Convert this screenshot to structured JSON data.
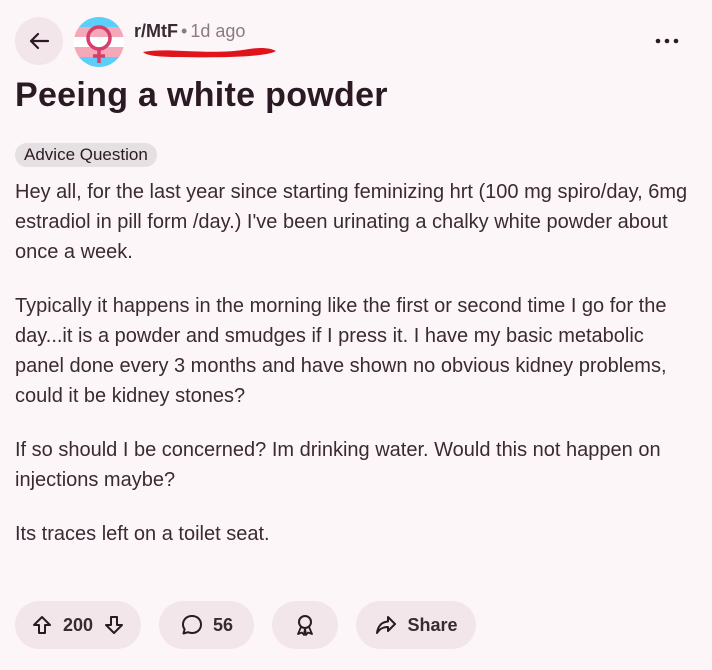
{
  "header": {
    "subreddit": "r/MtF",
    "separator": "•",
    "age": "1d ago"
  },
  "post": {
    "title": "Peeing a white powder",
    "flair": "Advice Question",
    "paragraphs": [
      "Hey all, for the last year since starting feminizing hrt (100 mg spiro/day, 6mg estradiol in pill form /day.) I've been urinating a chalky white powder about once a week.",
      "Typically it happens in the morning like the first or second time I go for the day...it is a powder and smudges if I press it. I have my basic metabolic panel done every 3 months and have shown no obvious kidney problems, could it be kidney stones?",
      "If so should I be concerned? Im drinking water. Would this not happen on injections maybe?",
      "Its traces left on a toilet seat."
    ]
  },
  "actions": {
    "votes": "200",
    "comments": "56",
    "share_label": "Share"
  },
  "icons": {
    "back": "arrow-left-icon",
    "more": "more-horizontal-icon",
    "upvote": "arrow-up-icon",
    "downvote": "arrow-down-icon",
    "comment": "speech-bubble-icon",
    "award": "award-ribbon-icon",
    "share": "share-arrow-icon"
  },
  "colors": {
    "background": "#fdf6f8",
    "pill": "#f3e6ea",
    "text": "#3a2a33",
    "muted": "#8a7a82",
    "redaction": "#e0141b",
    "flag_blue": "#5bcefa",
    "flag_pink": "#f5a9b8"
  }
}
